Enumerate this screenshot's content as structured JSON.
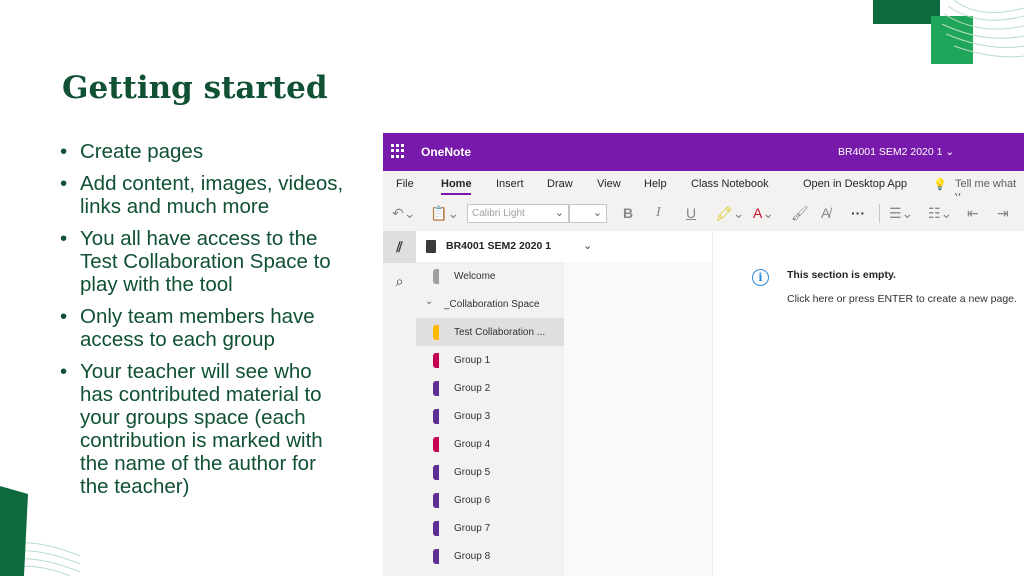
{
  "slide": {
    "title": "Getting started",
    "bullets": [
      "Create pages",
      "Add content, images, videos, links and much more",
      "You all have access to the Test Collaboration Space to play with the tool",
      "Only team members have access to each group",
      "Your teacher will see who has contributed material to your groups space (each contribution is marked with the name of the author for the teacher)"
    ]
  },
  "onenote": {
    "app_name": "OneNote",
    "notebook_title": "BR4001 SEM2 2020 1",
    "menu": [
      "File",
      "Home",
      "Insert",
      "Draw",
      "View",
      "Help",
      "Class Notebook",
      "Open in Desktop App",
      "Tell me what y"
    ],
    "active_menu": "Home",
    "toolbar": {
      "font_name": "Calibri Light",
      "font_size": "",
      "bold": "B",
      "italic": "I",
      "underline": "U",
      "more": "···"
    },
    "notebook_header": "BR4001 SEM2 2020 1",
    "sections": [
      {
        "label": "Welcome",
        "color": "#a19f9d"
      },
      {
        "label": "_Collaboration Space",
        "group": true
      },
      {
        "label": "Test Collaboration ...",
        "color": "#ffb900",
        "selected": true
      },
      {
        "label": "Group 1",
        "color": "#c30052"
      },
      {
        "label": "Group 2",
        "color": "#5c2e91"
      },
      {
        "label": "Group 3",
        "color": "#5c2e91"
      },
      {
        "label": "Group 4",
        "color": "#c30052"
      },
      {
        "label": "Group 5",
        "color": "#5c2e91"
      },
      {
        "label": "Group 6",
        "color": "#5c2e91"
      },
      {
        "label": "Group 7",
        "color": "#5c2e91"
      },
      {
        "label": "Group 8",
        "color": "#5c2e91"
      }
    ],
    "empty_state": {
      "title": "This section is empty.",
      "hint": "Click here or press ENTER to create a new page."
    },
    "colors": {
      "brand_purple": "#7719aa",
      "slide_green": "#0f5132",
      "deco_dark_green": "#0f6b3d",
      "deco_light_green": "#1fa65a"
    }
  }
}
